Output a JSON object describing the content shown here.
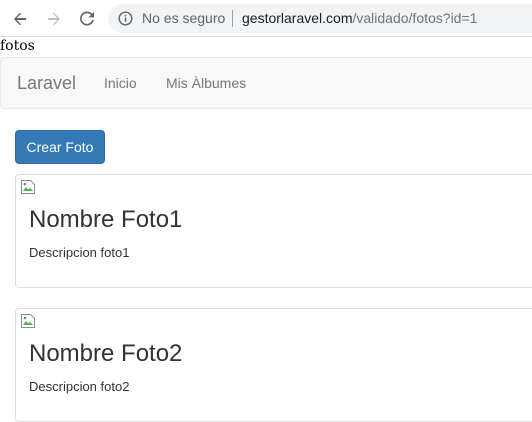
{
  "browser": {
    "security_label": "No es seguro",
    "url_host": "gestorlaravel.com",
    "url_path": "/validado/fotos?id=1"
  },
  "page": {
    "title_text": "fotos"
  },
  "navbar": {
    "brand": "Laravel",
    "links": [
      "Inicio",
      "Mis Àlbumes"
    ]
  },
  "actions": {
    "create_label": "Crear Foto"
  },
  "photos": [
    {
      "name": "Nombre Foto1",
      "description": "Descripcion foto1"
    },
    {
      "name": "Nombre Foto2",
      "description": "Descripcion foto2"
    }
  ],
  "colors": {
    "primary": "#337ab7",
    "navbar_bg": "#f8f8f8",
    "nav_text": "#777777"
  }
}
